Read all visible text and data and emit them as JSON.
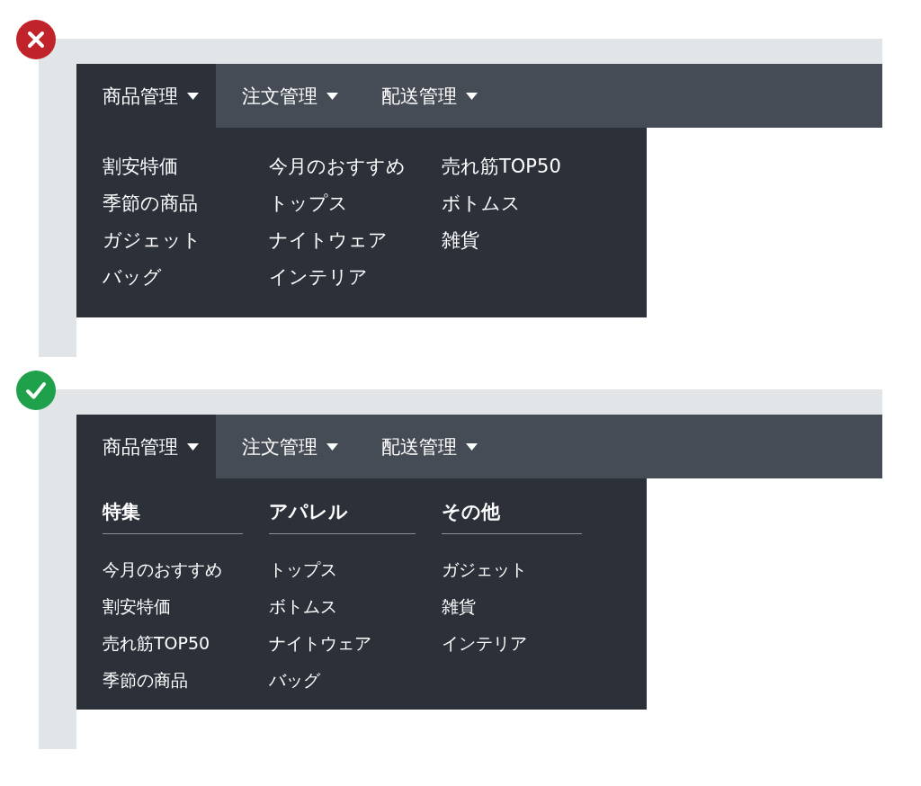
{
  "examples": [
    {
      "kind": "bad",
      "tabs": [
        {
          "label": "商品管理",
          "selected": true
        },
        {
          "label": "注文管理",
          "selected": false
        },
        {
          "label": "配送管理",
          "selected": false
        }
      ],
      "menu": {
        "columns": [
          {
            "items": [
              "割安特価",
              "季節の商品",
              "ガジェット",
              "バッグ"
            ]
          },
          {
            "items": [
              "今月のおすすめ",
              "トップス",
              "ナイトウェア",
              "インテリア"
            ]
          },
          {
            "items": [
              "売れ筋TOP50",
              "ボトムス",
              "雑貨"
            ]
          }
        ]
      }
    },
    {
      "kind": "good",
      "tabs": [
        {
          "label": "商品管理",
          "selected": true
        },
        {
          "label": "注文管理",
          "selected": false
        },
        {
          "label": "配送管理",
          "selected": false
        }
      ],
      "menu": {
        "columns": [
          {
            "heading": "特集",
            "items": [
              "今月のおすすめ",
              "割安特価",
              "売れ筋TOP50",
              "季節の商品"
            ]
          },
          {
            "heading": "アパレル",
            "items": [
              "トップス",
              "ボトムス",
              "ナイトウェア",
              "バッグ"
            ]
          },
          {
            "heading": "その他",
            "items": [
              "ガジェット",
              "雑貨",
              "インテリア"
            ]
          }
        ]
      }
    }
  ]
}
